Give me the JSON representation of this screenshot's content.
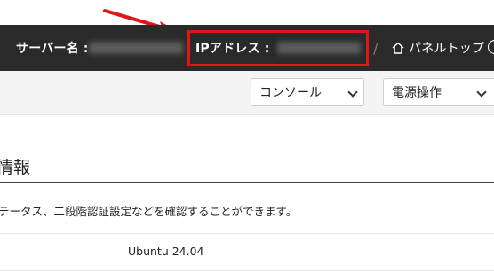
{
  "header": {
    "server_name_label": "サーバー名 :",
    "ip_address_label": "IPアドレス :",
    "separator": "/",
    "panel_top_label": "パネルトップ"
  },
  "toolbar": {
    "console_select": "コンソール",
    "power_select": "電源操作"
  },
  "content": {
    "section_title": "情報",
    "description": "テータス、二段階認証設定などを確認することができます。",
    "os_value": "Ubuntu 24.04"
  },
  "colors": {
    "highlight": "#e01515",
    "topbar": "#2a2a2a"
  }
}
